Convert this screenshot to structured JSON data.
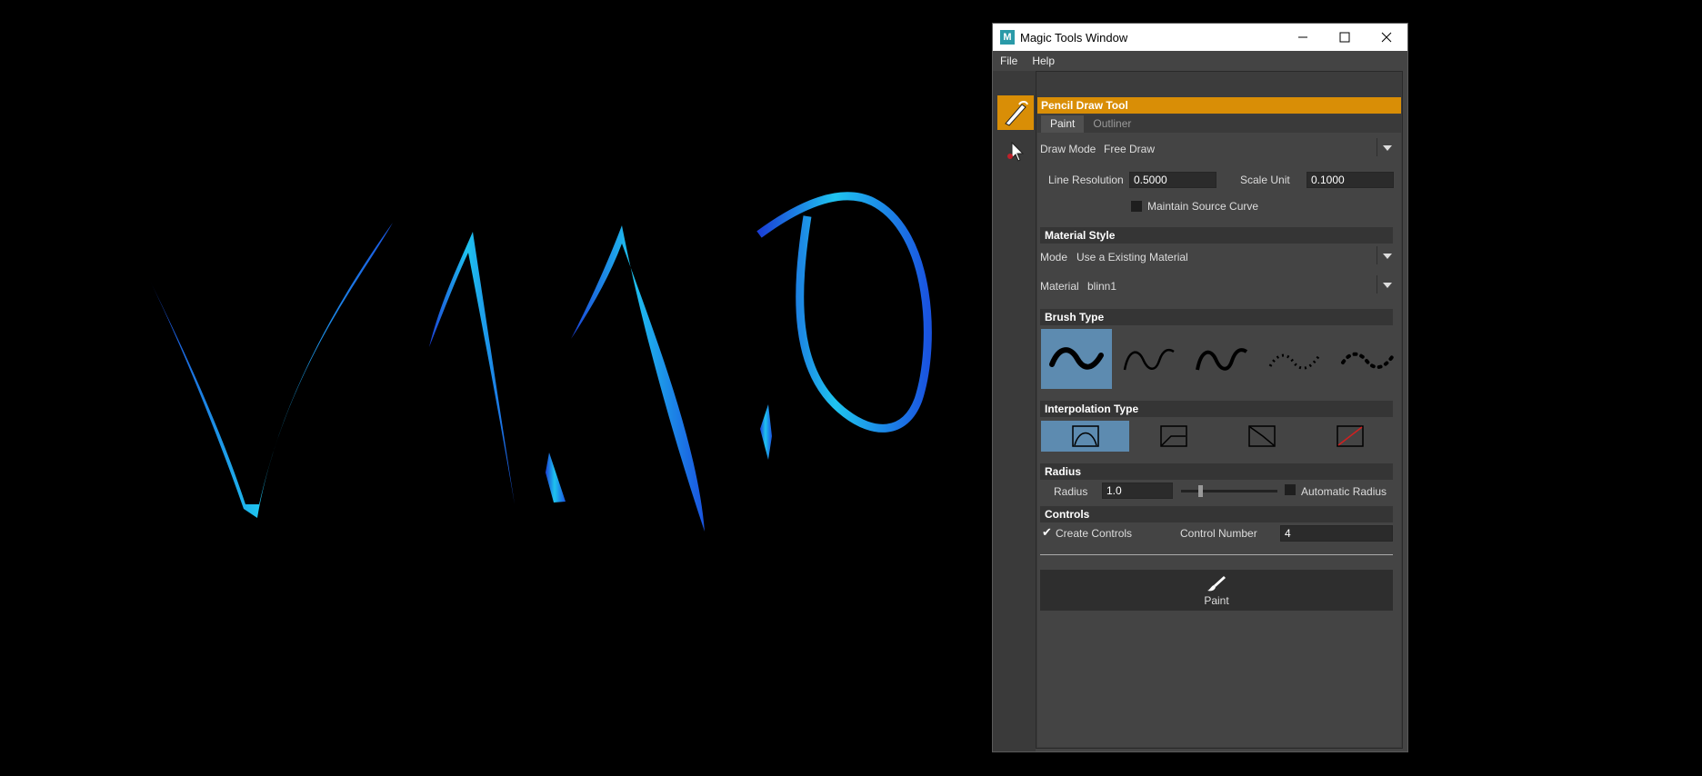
{
  "window": {
    "title": "Magic Tools Window",
    "app_icon_letter": "M",
    "controls": [
      "minimize-icon",
      "maximize-icon",
      "close-icon"
    ]
  },
  "menu": [
    "File",
    "Help"
  ],
  "sidebar": {
    "tools": [
      {
        "icon": "pencil-icon",
        "active": true
      },
      {
        "icon": "select-cursor-icon",
        "active": false
      }
    ]
  },
  "tool_header": "Pencil Draw Tool",
  "tabs": [
    {
      "label": "Paint",
      "active": true
    },
    {
      "label": "Outliner",
      "active": false
    }
  ],
  "draw_mode": {
    "label": "Draw Mode",
    "value": "Free Draw"
  },
  "line_resolution": {
    "label": "Line Resolution",
    "value": "0.5000"
  },
  "scale_unit": {
    "label": "Scale Unit",
    "value": "0.1000"
  },
  "maintain_source_curve": {
    "label": "Maintain Source Curve",
    "checked": false
  },
  "material_style": {
    "header": "Material Style",
    "mode_label": "Mode",
    "mode_value": "Use a Existing Material",
    "material_label": "Material",
    "material_value": "blinn1"
  },
  "brush_type": {
    "header": "Brush Type",
    "options": [
      "brush-solid-icon",
      "brush-thin-icon",
      "brush-taper-icon",
      "brush-dotted-icon",
      "brush-dots-icon"
    ],
    "selected": 0
  },
  "interpolation_type": {
    "header": "Interpolation Type",
    "options": [
      "interp-curve-icon",
      "interp-linear-icon",
      "interp-step-icon",
      "interp-none-icon"
    ],
    "selected": 0
  },
  "radius": {
    "header": "Radius",
    "label": "Radius",
    "value": "1.0",
    "slider_level": 0.2,
    "auto_label": "Automatic Radius",
    "auto_checked": false
  },
  "controls": {
    "header": "Controls",
    "create_label": "Create Controls",
    "create_checked": true,
    "check_glyph": "✔",
    "number_label": "Control Number",
    "number_value": "4"
  },
  "paint_button": {
    "label": "Paint",
    "icon": "paint-brush-icon"
  },
  "viewport": {
    "stroke_color": "#1fc4ef",
    "edge_color": "#1a3fd6"
  }
}
